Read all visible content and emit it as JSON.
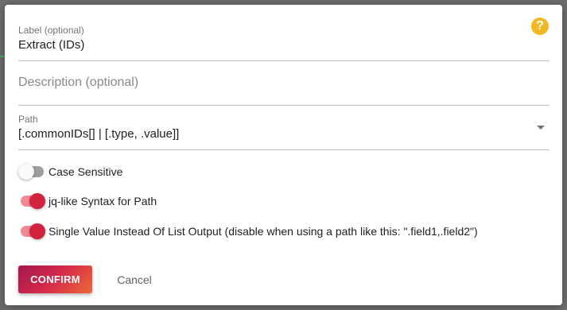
{
  "dialog": {
    "help_icon": "?",
    "label_field": {
      "label": "Label (optional)",
      "value": "Extract (IDs)"
    },
    "description_field": {
      "placeholder": "Description (optional)"
    },
    "path_field": {
      "label": "Path",
      "value": "[.commonIDs[] | [.type, .value]]"
    },
    "toggles": [
      {
        "label": "Case Sensitive",
        "checked": false
      },
      {
        "label": "jq-like Syntax for Path",
        "checked": true
      },
      {
        "label": "Single Value Instead Of List Output (disable when using a path like this: \".field1,.field2\")",
        "checked": true
      }
    ],
    "buttons": {
      "confirm": "CONFIRM",
      "cancel": "Cancel"
    }
  },
  "colors": {
    "accent": "#d2223e",
    "help_icon": "#f2b824",
    "toggle_off": "#9e9e9e"
  }
}
